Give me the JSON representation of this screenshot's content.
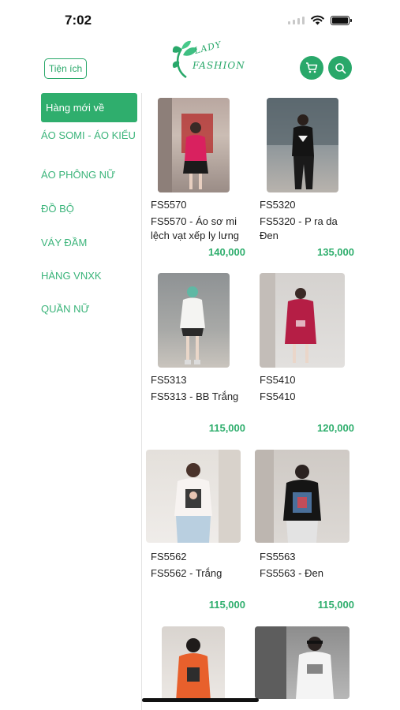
{
  "status": {
    "time": "7:02"
  },
  "header": {
    "utility_button": "Tiện ích",
    "logo_line1": "LADY",
    "logo_line2": "FASHION",
    "cart_icon": "cart-icon",
    "search_icon": "search-icon",
    "accent_color": "#2fae6d"
  },
  "categories": [
    {
      "label": "Hàng mới về",
      "active": true
    },
    {
      "label": "ÁO SOMI - ÁO KIỂU",
      "active": false
    },
    {
      "label": "ÁO PHÔNG NỮ",
      "active": false
    },
    {
      "label": "ĐỒ BỘ",
      "active": false
    },
    {
      "label": "VÁY ĐẦM",
      "active": false
    },
    {
      "label": "HÀNG VNXK",
      "active": false
    },
    {
      "label": "QUẦN NỮ",
      "active": false
    }
  ],
  "products": [
    {
      "code": "FS5570",
      "name": "FS5570 - Áo sơ mi lệch vạt xếp ly lưng",
      "price": "140,000"
    },
    {
      "code": "FS5320",
      "name": "FS5320 - P ra da Đen",
      "price": "135,000"
    },
    {
      "code": "FS5313",
      "name": "FS5313 - BB Trắng",
      "price": "115,000"
    },
    {
      "code": "FS5410",
      "name": "FS5410",
      "price": "120,000"
    },
    {
      "code": "FS5562",
      "name": "FS5562 - Trắng",
      "price": "115,000"
    },
    {
      "code": "FS5563",
      "name": "FS5563 - Đen",
      "price": "115,000"
    },
    {
      "code": "",
      "name": "",
      "price": ""
    },
    {
      "code": "",
      "name": "",
      "price": ""
    }
  ]
}
